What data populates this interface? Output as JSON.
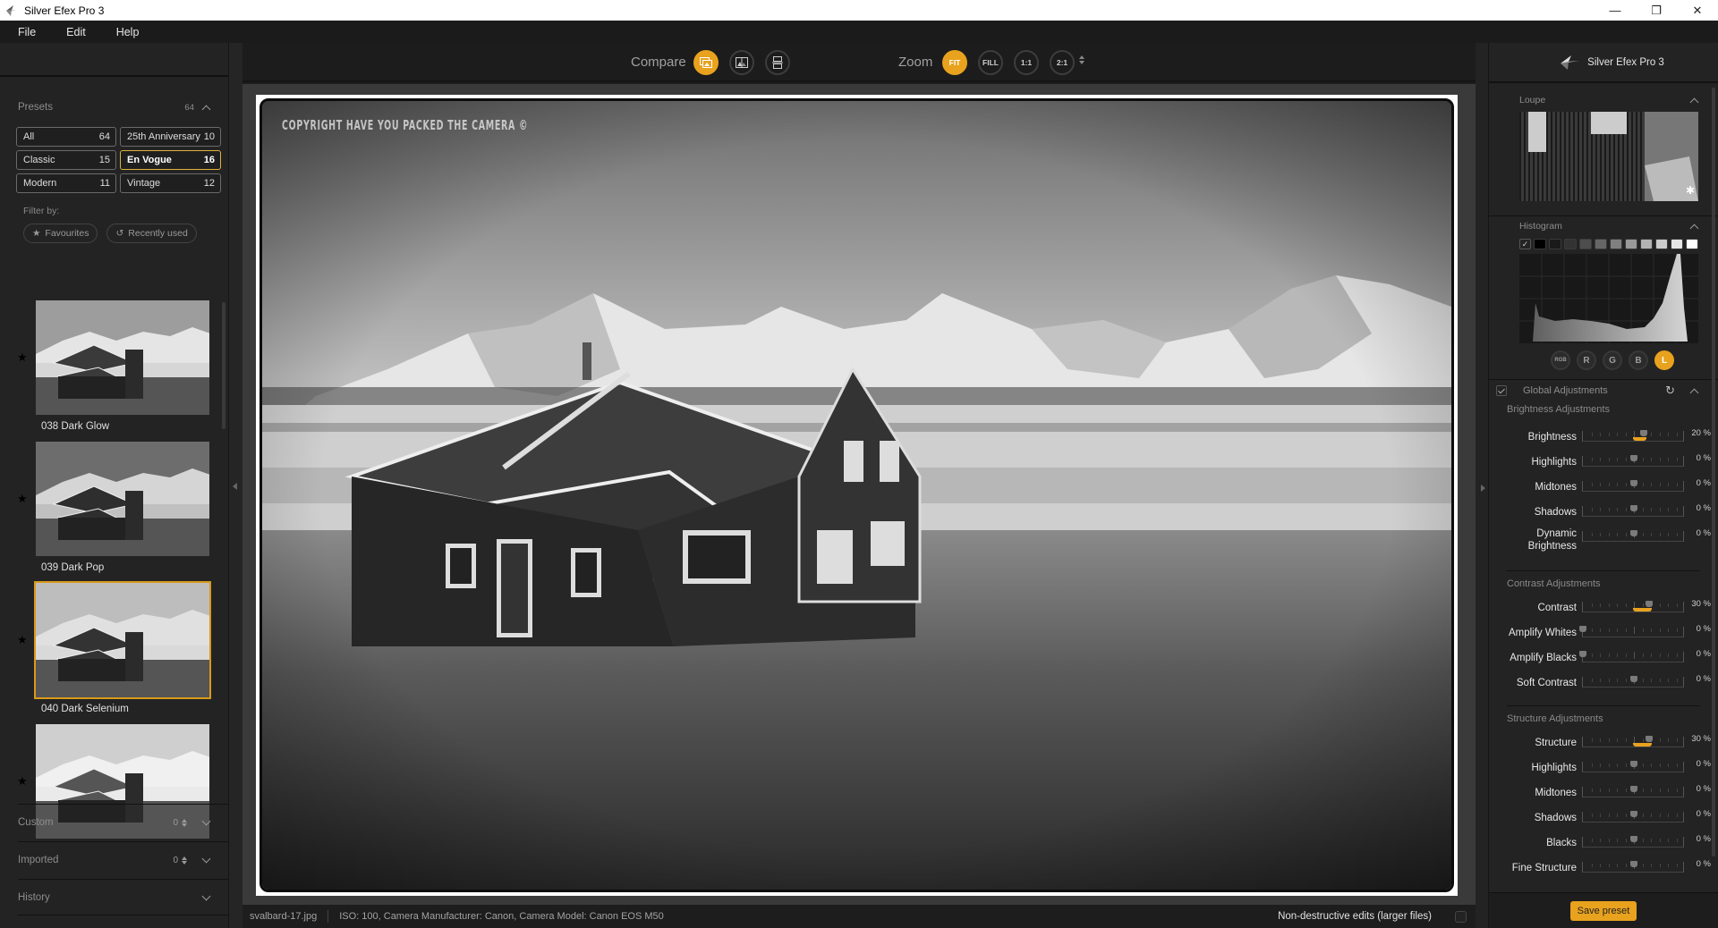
{
  "window": {
    "title": "Silver Efex Pro 3",
    "controls": [
      "minimize",
      "restore",
      "close"
    ]
  },
  "menu": [
    "File",
    "Edit",
    "Help"
  ],
  "presets": {
    "title": "Presets",
    "count": "64",
    "categories": [
      {
        "label": "All",
        "count": "64",
        "active": false
      },
      {
        "label": "25th Anniversary",
        "count": "10",
        "active": false
      },
      {
        "label": "Classic",
        "count": "15",
        "active": false
      },
      {
        "label": "En Vogue",
        "count": "16",
        "active": true
      },
      {
        "label": "Modern",
        "count": "11",
        "active": false
      },
      {
        "label": "Vintage",
        "count": "12",
        "active": false
      }
    ],
    "filter_label": "Filter by:",
    "filters": [
      {
        "label": "Favourites",
        "icon": "star-icon"
      },
      {
        "label": "Recently used",
        "icon": "history-icon"
      }
    ],
    "thumbnails": [
      {
        "label": "038 Dark Glow",
        "favourite": true,
        "selected": false
      },
      {
        "label": "039 Dark Pop",
        "favourite": true,
        "selected": false
      },
      {
        "label": "040 Dark Selenium",
        "favourite": true,
        "selected": true
      },
      {
        "label": "",
        "favourite": true,
        "selected": false
      }
    ],
    "sections": [
      {
        "label": "Custom",
        "count": "0"
      },
      {
        "label": "Imported",
        "count": "0"
      },
      {
        "label": "History",
        "count": ""
      }
    ]
  },
  "toolbar": {
    "compare_label": "Compare",
    "compare_buttons": [
      "single-view",
      "split-view",
      "side-by-side"
    ],
    "zoom_label": "Zoom",
    "zoom_buttons": [
      {
        "label": "FIT",
        "active": true
      },
      {
        "label": "FILL",
        "active": false
      },
      {
        "label": "1:1",
        "active": false
      },
      {
        "label": "2:1",
        "active": false
      }
    ]
  },
  "image": {
    "watermark": "Copyright Have you Packed the Camera ©"
  },
  "status": {
    "filename": "svalbard-17.jpg",
    "exif": "ISO: 100, Camera Manufacturer: Canon, Camera Model: Canon EOS M50",
    "nondestructive_label": "Non-destructive edits (larger files)",
    "nondestructive_checked": false
  },
  "right": {
    "brand": "Silver Efex Pro 3",
    "loupe_title": "Loupe",
    "histogram_title": "Histogram",
    "histogram_channels": [
      {
        "label": "RGB",
        "active": false
      },
      {
        "label": "R",
        "active": false
      },
      {
        "label": "G",
        "active": false
      },
      {
        "label": "B",
        "active": false
      },
      {
        "label": "L",
        "active": true
      }
    ],
    "global_title": "Global Adjustments",
    "groups": [
      {
        "title": "Brightness Adjustments",
        "sliders": [
          {
            "label": "Brightness",
            "value": 20,
            "display": "20 %",
            "center": true
          },
          {
            "label": "Highlights",
            "value": 0,
            "display": "0 %",
            "center": true
          },
          {
            "label": "Midtones",
            "value": 0,
            "display": "0 %",
            "center": true
          },
          {
            "label": "Shadows",
            "value": 0,
            "display": "0 %",
            "center": true
          },
          {
            "label": "Dynamic Brightness",
            "value": 0,
            "display": "0 %",
            "center": true
          }
        ]
      },
      {
        "title": "Contrast Adjustments",
        "sliders": [
          {
            "label": "Contrast",
            "value": 30,
            "display": "30 %",
            "center": true
          },
          {
            "label": "Amplify Whites",
            "value": 0,
            "display": "0 %",
            "center": false
          },
          {
            "label": "Amplify Blacks",
            "value": 0,
            "display": "0 %",
            "center": false
          },
          {
            "label": "Soft Contrast",
            "value": 0,
            "display": "0 %",
            "center": true
          }
        ]
      },
      {
        "title": "Structure Adjustments",
        "sliders": [
          {
            "label": "Structure",
            "value": 30,
            "display": "30 %",
            "center": true
          },
          {
            "label": "Highlights",
            "value": 0,
            "display": "0 %",
            "center": true
          },
          {
            "label": "Midtones",
            "value": 0,
            "display": "0 %",
            "center": true
          },
          {
            "label": "Shadows",
            "value": 0,
            "display": "0 %",
            "center": true
          },
          {
            "label": "Blacks",
            "value": 0,
            "display": "0 %",
            "center": true
          },
          {
            "label": "Fine Structure",
            "value": 0,
            "display": "0 %",
            "center": true
          }
        ]
      }
    ],
    "save_label": "Save preset",
    "accent": "#e8a21e"
  }
}
